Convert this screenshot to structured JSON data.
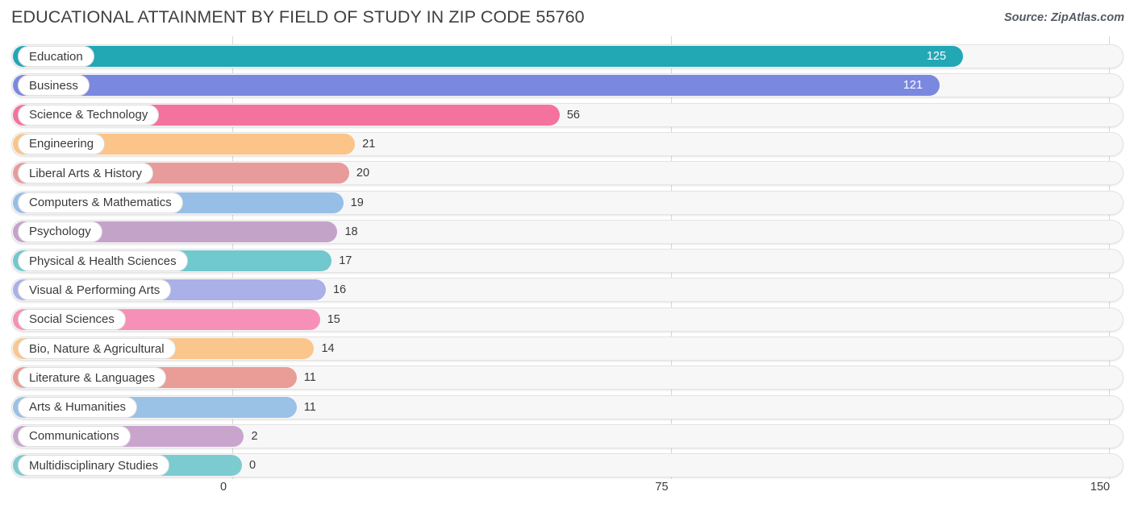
{
  "header": {
    "title": "EDUCATIONAL ATTAINMENT BY FIELD OF STUDY IN ZIP CODE 55760",
    "source": "Source: ZipAtlas.com"
  },
  "chart_data": {
    "type": "bar",
    "orientation": "horizontal",
    "title": "EDUCATIONAL ATTAINMENT BY FIELD OF STUDY IN ZIP CODE 55760",
    "xlabel": "",
    "ylabel": "",
    "xlim": [
      0,
      150
    ],
    "ticks": [
      "0",
      "75",
      "150"
    ],
    "tick_values": [
      0,
      75,
      150
    ],
    "grid": true,
    "legend": false,
    "categories": [
      "Education",
      "Business",
      "Science & Technology",
      "Engineering",
      "Liberal Arts & History",
      "Computers & Mathematics",
      "Psychology",
      "Physical & Health Sciences",
      "Visual & Performing Arts",
      "Social Sciences",
      "Bio, Nature & Agricultural",
      "Literature & Languages",
      "Arts & Humanities",
      "Communications",
      "Multidisciplinary Studies"
    ],
    "values": [
      125,
      121,
      56,
      21,
      20,
      19,
      18,
      17,
      16,
      15,
      14,
      11,
      11,
      2,
      0
    ],
    "value_labels": [
      "125",
      "121",
      "56",
      "21",
      "20",
      "19",
      "18",
      "17",
      "16",
      "15",
      "14",
      "11",
      "11",
      "2",
      "0"
    ],
    "colors": [
      "#22a7b5",
      "#7b88e0",
      "#f4729e",
      "#fbc489",
      "#e89b9b",
      "#97bee6",
      "#c4a3c9",
      "#71c8cd",
      "#aab0e8",
      "#f790b8",
      "#fbc68c",
      "#e89d96",
      "#9ac1e6",
      "#c9a5ce",
      "#7ccbd1"
    ]
  },
  "colors": {
    "track_bg": "#f7f7f7",
    "track_border": "#e3e3e3",
    "gridline": "#d8d8d8",
    "text": "#3a3a3a"
  }
}
